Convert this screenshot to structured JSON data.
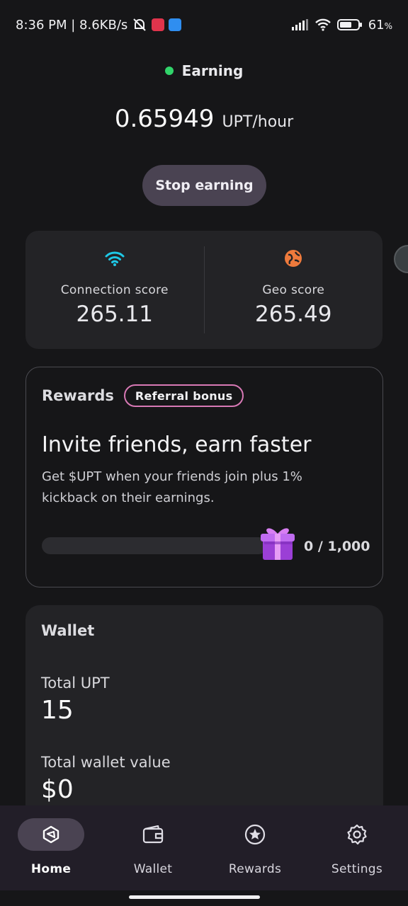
{
  "status_bar": {
    "time_speed": "8:36 PM | 8.6KB/s",
    "battery": "61",
    "battery_unit": "%"
  },
  "header": {
    "earning_status": "Earning",
    "rate_value": "0.65949",
    "rate_unit": "UPT/hour",
    "stop_button": "Stop earning"
  },
  "scores": {
    "connection": {
      "label": "Connection score",
      "value": "265.11",
      "icon": "wifi-icon",
      "color": "#1ec8e6"
    },
    "geo": {
      "label": "Geo score",
      "value": "265.49",
      "icon": "globe-icon",
      "color": "#ee7a3c"
    }
  },
  "rewards": {
    "title": "Rewards",
    "badge": "Referral bonus",
    "heading": "Invite friends, earn faster",
    "description": "Get $UPT when your friends join plus 1% kickback on their earnings.",
    "progress_text": "0 / 1,000",
    "progress_fraction": 0
  },
  "wallet": {
    "title": "Wallet",
    "total_upt_label": "Total UPT",
    "total_upt_value": "15",
    "wallet_value_label": "Total wallet value",
    "wallet_value": "$0"
  },
  "nav": {
    "items": [
      {
        "label": "Home",
        "icon": "home-shield-icon",
        "active": true
      },
      {
        "label": "Wallet",
        "icon": "wallet-icon",
        "active": false
      },
      {
        "label": "Rewards",
        "icon": "star-circle-icon",
        "active": false
      },
      {
        "label": "Settings",
        "icon": "gear-icon",
        "active": false
      }
    ]
  },
  "colors": {
    "background": "#161618",
    "card": "#232326",
    "accent_button": "#4a4352",
    "earning_dot": "#31d46a",
    "referral_border": "#d879b5"
  }
}
